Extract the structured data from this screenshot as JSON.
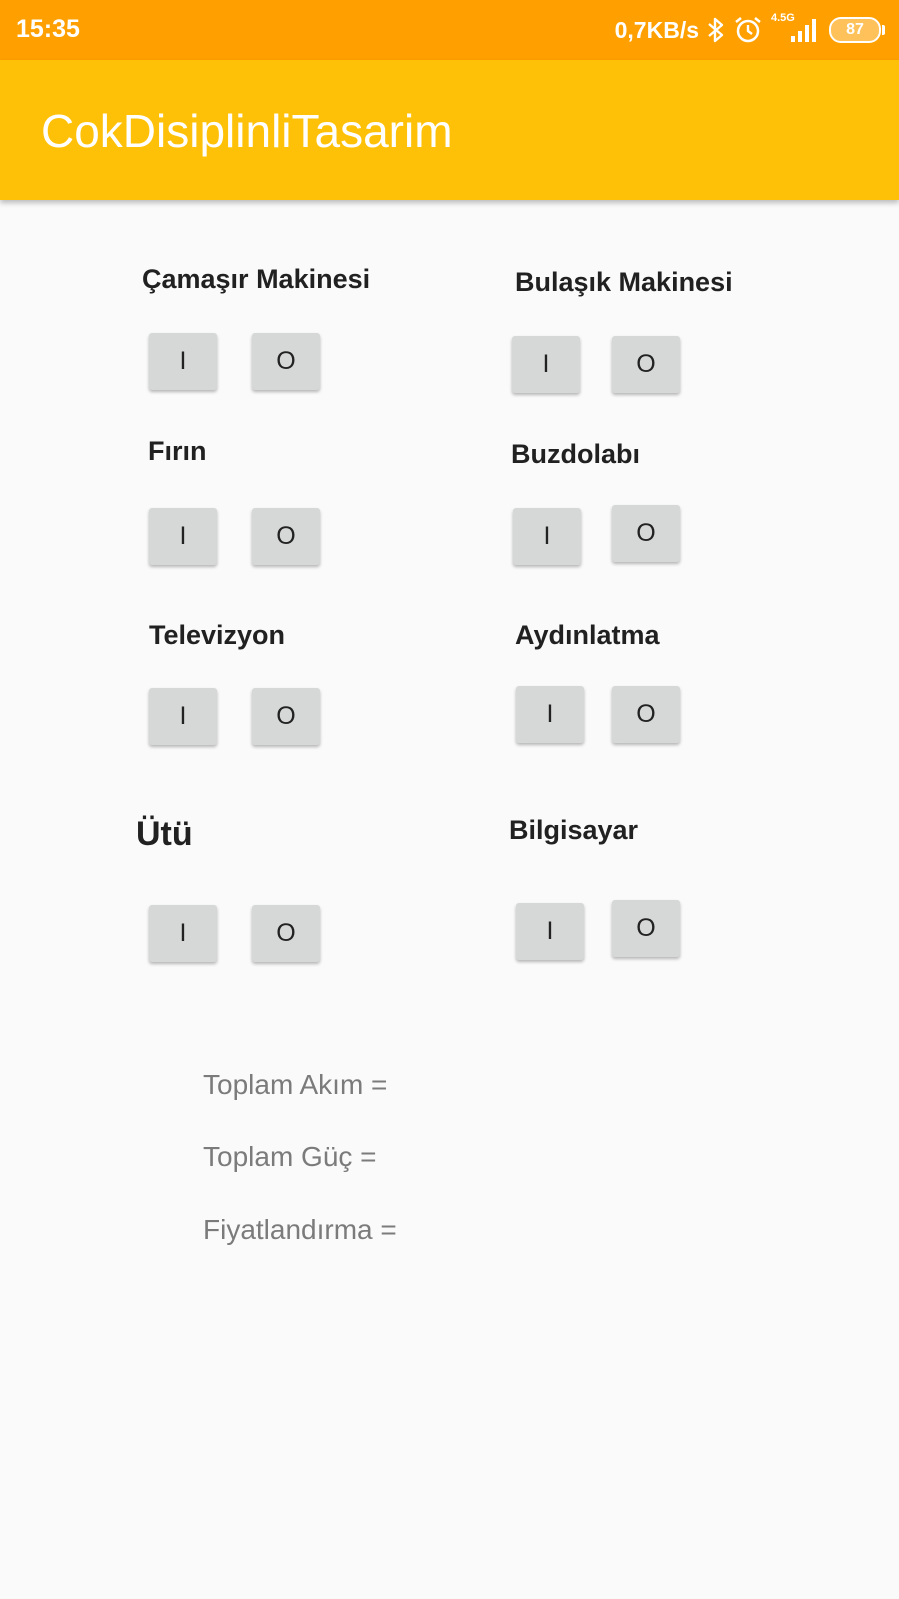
{
  "status_bar": {
    "time": "15:35",
    "net_speed": "0,7KB/s",
    "signal_label": "4.5G",
    "battery": "87",
    "icons": [
      "bluetooth-icon",
      "alarm-icon",
      "signal-icon",
      "battery-icon"
    ]
  },
  "app_bar": {
    "title": "CokDisiplinliTasarim",
    "color": "#ffc107",
    "status_color": "#ffa000"
  },
  "appliances": [
    {
      "name": "Çamaşır Makinesi",
      "on_label": "I",
      "off_label": "O"
    },
    {
      "name": "Bulaşık Makinesi",
      "on_label": "I",
      "off_label": "O"
    },
    {
      "name": "Fırın",
      "on_label": "I",
      "off_label": "O"
    },
    {
      "name": "Buzdolabı",
      "on_label": "I",
      "off_label": "O"
    },
    {
      "name": "Televizyon",
      "on_label": "I",
      "off_label": "O"
    },
    {
      "name": "Aydınlatma",
      "on_label": "I",
      "off_label": "O"
    },
    {
      "name": "Ütü",
      "on_label": "I",
      "off_label": "O"
    },
    {
      "name": "Bilgisayar",
      "on_label": "I",
      "off_label": "O"
    }
  ],
  "summary": {
    "total_current": "Toplam Akım =",
    "total_power": "Toplam Güç =",
    "pricing": "Fiyatlandırma ="
  }
}
